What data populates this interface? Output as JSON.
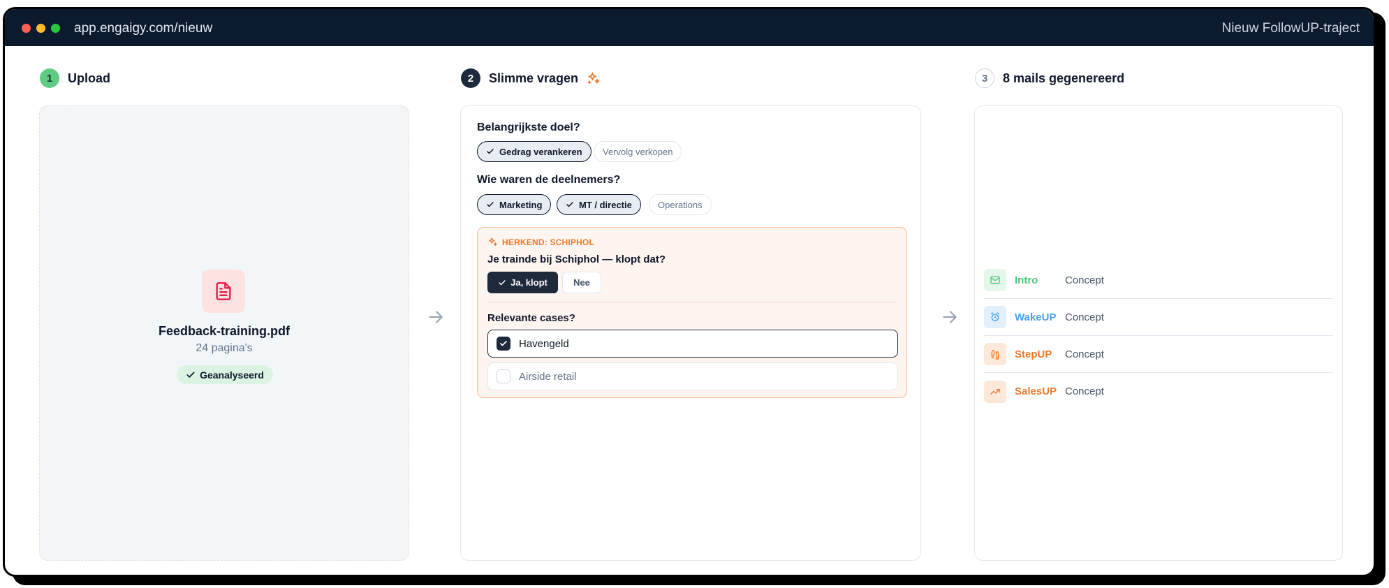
{
  "window": {
    "url": "app.engaigy.com/nieuw",
    "title": "Nieuw FollowUP-traject",
    "dots": [
      "#ff5f57",
      "#febc2e",
      "#28c840"
    ]
  },
  "steps": [
    {
      "number": "1",
      "label": "Upload"
    },
    {
      "number": "2",
      "label": "Slimme vragen"
    },
    {
      "number": "3",
      "label": "8 mails gegenereerd"
    }
  ],
  "upload": {
    "filename": "Feedback-training.pdf",
    "pages": "24 pagina's",
    "status": "Geanalyseerd",
    "file_icon": "file-text-icon"
  },
  "questions": {
    "goal_label": "Belangrijkste doel?",
    "goal_options": [
      {
        "label": "Gedrag verankeren",
        "selected": true
      },
      {
        "label": "Vervolg verkopen",
        "selected": false
      }
    ],
    "participants_label": "Wie waren de deelnemers?",
    "participant_options": [
      {
        "label": "Marketing",
        "selected": true
      },
      {
        "label": "MT / directie",
        "selected": true
      },
      {
        "label": "Operations",
        "selected": false
      }
    ],
    "recognized": {
      "tag": "HERKEND: SCHIPHOL",
      "question": "Je trainde bij Schiphol — klopt dat?",
      "yes_label": "Ja, klopt",
      "no_label": "Nee",
      "cases_label": "Relevante cases?",
      "cases": [
        {
          "label": "Havengeld",
          "checked": true
        },
        {
          "label": "Airside retail",
          "checked": false
        }
      ]
    }
  },
  "mails": [
    {
      "name": "Intro",
      "status": "Concept",
      "color": "#4ec47a",
      "bg": "#e5f6ea",
      "icon": "mail-icon"
    },
    {
      "name": "WakeUP",
      "status": "Concept",
      "color": "#4a9ee8",
      "bg": "#e3f0fc",
      "icon": "alarm-clock-icon"
    },
    {
      "name": "StepUP",
      "status": "Concept",
      "color": "#e97a2c",
      "bg": "#fde8da",
      "icon": "footprints-icon"
    },
    {
      "name": "SalesUP",
      "status": "Concept",
      "color": "#e97a2c",
      "bg": "#fde8da",
      "icon": "trending-up-icon"
    }
  ],
  "colors": {
    "navy": "#0c1a2e",
    "accent_orange": "#e97a2c",
    "success_green": "#4ec47a",
    "pdf_red": "#e11d48"
  }
}
